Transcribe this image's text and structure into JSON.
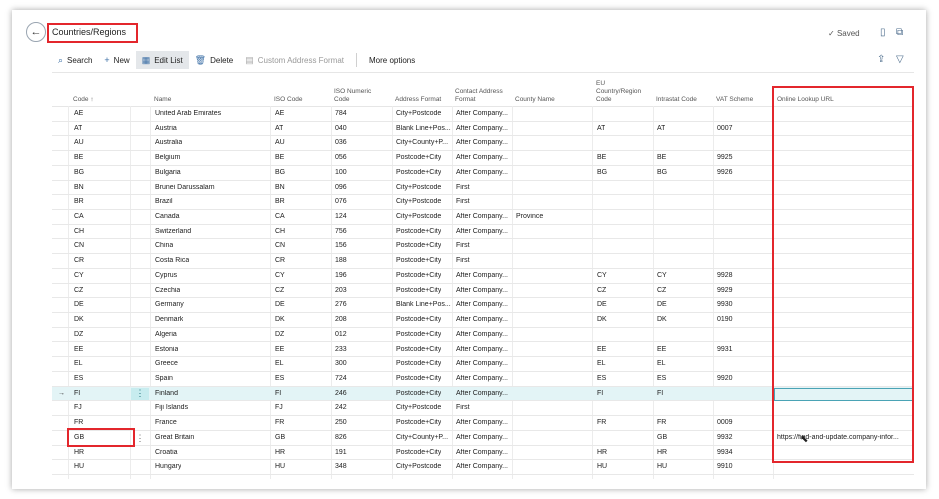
{
  "header": {
    "title": "Countries/Regions",
    "saved_label": "Saved",
    "back_icon": "arrow-left-icon",
    "bookmark_icon": "bookmark-icon",
    "open_new_icon": "open-new-window-icon"
  },
  "toolbar": {
    "search_label": "Search",
    "new_label": "New",
    "edit_list_label": "Edit List",
    "delete_label": "Delete",
    "custom_address_label": "Custom Address Format",
    "more_options_label": "More options",
    "share_icon": "share-icon",
    "filter_icon": "filter-icon"
  },
  "columns": {
    "code": "Code ↑",
    "name": "Name",
    "iso_code": "ISO Code",
    "iso_numeric_l1": "ISO Numeric",
    "iso_numeric_l2": "Code",
    "address_format": "Address Format",
    "contact_l1": "Contact Address",
    "contact_l2": "Format",
    "county_name": "County Name",
    "eu_l1": "EU",
    "eu_l2": "Country/Region",
    "eu_l3": "Code",
    "intrastat": "Intrastat Code",
    "vat": "VAT Scheme",
    "url": "Online Lookup URL"
  },
  "rows": [
    {
      "code": "AE",
      "name": "United Arab Emirates",
      "iso": "AE",
      "num": "784",
      "addr": "City+Postcode",
      "contact": "After Company...",
      "county": "",
      "eu": "",
      "intra": "",
      "vat": "",
      "url": ""
    },
    {
      "code": "AT",
      "name": "Austria",
      "iso": "AT",
      "num": "040",
      "addr": "Blank Line+Pos...",
      "contact": "After Company...",
      "county": "",
      "eu": "AT",
      "intra": "AT",
      "vat": "0007",
      "url": ""
    },
    {
      "code": "AU",
      "name": "Australia",
      "iso": "AU",
      "num": "036",
      "addr": "City+County+P...",
      "contact": "After Company...",
      "county": "",
      "eu": "",
      "intra": "",
      "vat": "",
      "url": ""
    },
    {
      "code": "BE",
      "name": "Belgium",
      "iso": "BE",
      "num": "056",
      "addr": "Postcode+City",
      "contact": "After Company...",
      "county": "",
      "eu": "BE",
      "intra": "BE",
      "vat": "9925",
      "url": ""
    },
    {
      "code": "BG",
      "name": "Bulgaria",
      "iso": "BG",
      "num": "100",
      "addr": "Postcode+City",
      "contact": "After Company...",
      "county": "",
      "eu": "BG",
      "intra": "BG",
      "vat": "9926",
      "url": ""
    },
    {
      "code": "BN",
      "name": "Brunei Darussalam",
      "iso": "BN",
      "num": "096",
      "addr": "City+Postcode",
      "contact": "First",
      "county": "",
      "eu": "",
      "intra": "",
      "vat": "",
      "url": ""
    },
    {
      "code": "BR",
      "name": "Brazil",
      "iso": "BR",
      "num": "076",
      "addr": "City+Postcode",
      "contact": "First",
      "county": "",
      "eu": "",
      "intra": "",
      "vat": "",
      "url": ""
    },
    {
      "code": "CA",
      "name": "Canada",
      "iso": "CA",
      "num": "124",
      "addr": "City+Postcode",
      "contact": "After Company...",
      "county": "Province",
      "eu": "",
      "intra": "",
      "vat": "",
      "url": ""
    },
    {
      "code": "CH",
      "name": "Switzerland",
      "iso": "CH",
      "num": "756",
      "addr": "Postcode+City",
      "contact": "After Company...",
      "county": "",
      "eu": "",
      "intra": "",
      "vat": "",
      "url": ""
    },
    {
      "code": "CN",
      "name": "China",
      "iso": "CN",
      "num": "156",
      "addr": "Postcode+City",
      "contact": "First",
      "county": "",
      "eu": "",
      "intra": "",
      "vat": "",
      "url": ""
    },
    {
      "code": "CR",
      "name": "Costa Rica",
      "iso": "CR",
      "num": "188",
      "addr": "Postcode+City",
      "contact": "First",
      "county": "",
      "eu": "",
      "intra": "",
      "vat": "",
      "url": ""
    },
    {
      "code": "CY",
      "name": "Cyprus",
      "iso": "CY",
      "num": "196",
      "addr": "Postcode+City",
      "contact": "After Company...",
      "county": "",
      "eu": "CY",
      "intra": "CY",
      "vat": "9928",
      "url": ""
    },
    {
      "code": "CZ",
      "name": "Czechia",
      "iso": "CZ",
      "num": "203",
      "addr": "Postcode+City",
      "contact": "After Company...",
      "county": "",
      "eu": "CZ",
      "intra": "CZ",
      "vat": "9929",
      "url": ""
    },
    {
      "code": "DE",
      "name": "Germany",
      "iso": "DE",
      "num": "276",
      "addr": "Blank Line+Pos...",
      "contact": "After Company...",
      "county": "",
      "eu": "DE",
      "intra": "DE",
      "vat": "9930",
      "url": ""
    },
    {
      "code": "DK",
      "name": "Denmark",
      "iso": "DK",
      "num": "208",
      "addr": "Postcode+City",
      "contact": "After Company...",
      "county": "",
      "eu": "DK",
      "intra": "DK",
      "vat": "0190",
      "url": ""
    },
    {
      "code": "DZ",
      "name": "Algeria",
      "iso": "DZ",
      "num": "012",
      "addr": "Postcode+City",
      "contact": "After Company...",
      "county": "",
      "eu": "",
      "intra": "",
      "vat": "",
      "url": ""
    },
    {
      "code": "EE",
      "name": "Estonia",
      "iso": "EE",
      "num": "233",
      "addr": "Postcode+City",
      "contact": "After Company...",
      "county": "",
      "eu": "EE",
      "intra": "EE",
      "vat": "9931",
      "url": ""
    },
    {
      "code": "EL",
      "name": "Greece",
      "iso": "EL",
      "num": "300",
      "addr": "Postcode+City",
      "contact": "After Company...",
      "county": "",
      "eu": "EL",
      "intra": "EL",
      "vat": "",
      "url": ""
    },
    {
      "code": "ES",
      "name": "Spain",
      "iso": "ES",
      "num": "724",
      "addr": "Postcode+City",
      "contact": "After Company...",
      "county": "",
      "eu": "ES",
      "intra": "ES",
      "vat": "9920",
      "url": ""
    },
    {
      "code": "FI",
      "name": "Finland",
      "iso": "FI",
      "num": "246",
      "addr": "Postcode+City",
      "contact": "After Company...",
      "county": "",
      "eu": "FI",
      "intra": "FI",
      "vat": "",
      "url": ""
    },
    {
      "code": "FJ",
      "name": "Fiji Islands",
      "iso": "FJ",
      "num": "242",
      "addr": "City+Postcode",
      "contact": "First",
      "county": "",
      "eu": "",
      "intra": "",
      "vat": "",
      "url": ""
    },
    {
      "code": "FR",
      "name": "France",
      "iso": "FR",
      "num": "250",
      "addr": "Postcode+City",
      "contact": "After Company...",
      "county": "",
      "eu": "FR",
      "intra": "FR",
      "vat": "0009",
      "url": ""
    },
    {
      "code": "GB",
      "name": "Great Britain",
      "iso": "GB",
      "num": "826",
      "addr": "City+County+P...",
      "contact": "After Company...",
      "county": "",
      "eu": "",
      "intra": "GB",
      "vat": "9932",
      "url": "https://find-and-update.company-infor..."
    },
    {
      "code": "HR",
      "name": "Croatia",
      "iso": "HR",
      "num": "191",
      "addr": "Postcode+City",
      "contact": "After Company...",
      "county": "",
      "eu": "HR",
      "intra": "HR",
      "vat": "9934",
      "url": ""
    },
    {
      "code": "HU",
      "name": "Hungary",
      "iso": "HU",
      "num": "348",
      "addr": "City+Postcode",
      "contact": "After Company...",
      "county": "",
      "eu": "HU",
      "intra": "HU",
      "vat": "9910",
      "url": ""
    }
  ],
  "selection": {
    "row_marker": "→",
    "menu_dots": "⋮"
  }
}
